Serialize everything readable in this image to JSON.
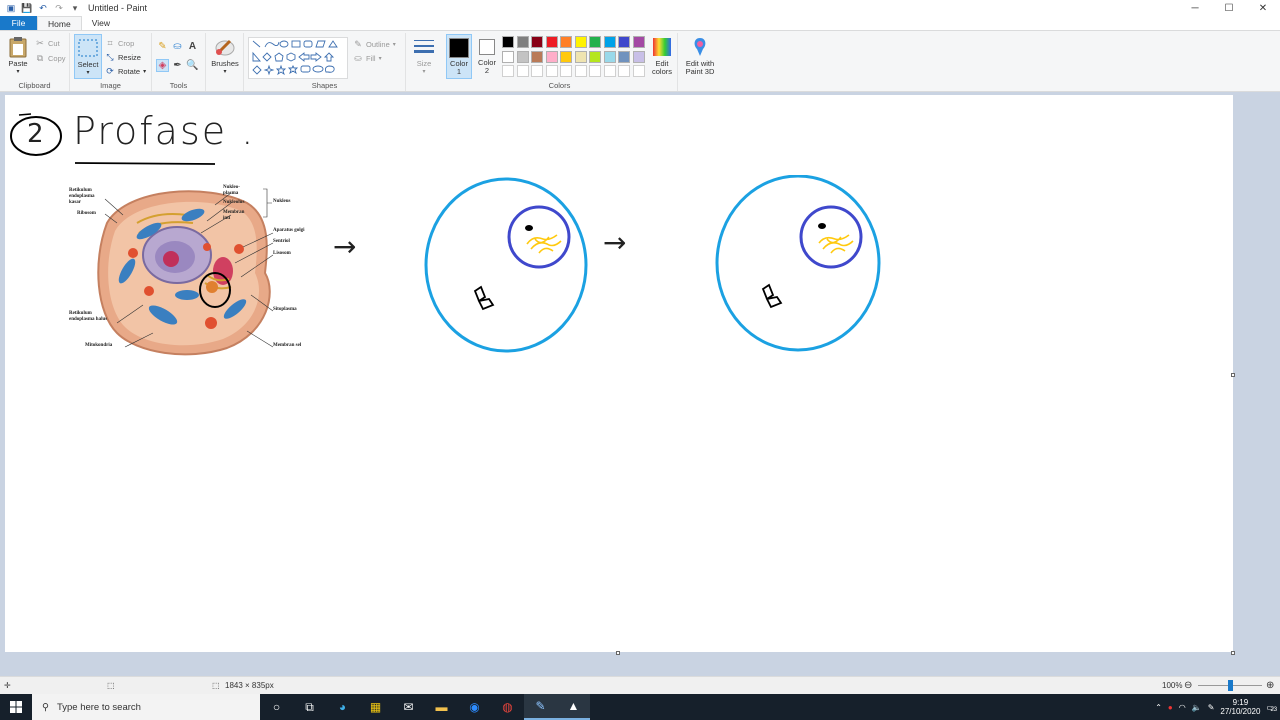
{
  "window": {
    "title": "Untitled - Paint",
    "controls": {
      "minimize": "─",
      "maximize": "☐",
      "close": "✕"
    }
  },
  "menu": {
    "file": "File",
    "tabs": [
      "Home",
      "View"
    ],
    "active_tab": "Home"
  },
  "ribbon": {
    "clipboard": {
      "label": "Clipboard",
      "paste": "Paste",
      "cut": "Cut",
      "copy": "Copy"
    },
    "image": {
      "label": "Image",
      "select": "Select",
      "crop": "Crop",
      "resize": "Resize",
      "rotate": "Rotate"
    },
    "tools": {
      "label": "Tools"
    },
    "brushes": {
      "label": "Brushes"
    },
    "shapes": {
      "label": "Shapes",
      "outline": "Outline",
      "fill": "Fill"
    },
    "size": {
      "label": "Size"
    },
    "color1": {
      "label": "Color\n1",
      "value": "#000000"
    },
    "color2": {
      "label": "Color\n2",
      "value": "#ffffff"
    },
    "colors": {
      "label": "Colors"
    },
    "edit_colors": "Edit\ncolors",
    "edit_paint3d": "Edit with\nPaint 3D",
    "palette_row1": [
      "#000000",
      "#7f7f7f",
      "#880015",
      "#ed1c24",
      "#ff7f27",
      "#fff200",
      "#22b14c",
      "#00a2e8",
      "#3f48cc",
      "#a349a4"
    ],
    "palette_row2": [
      "#ffffff",
      "#c3c3c3",
      "#b97a57",
      "#ffaec9",
      "#ffc90e",
      "#efe4b0",
      "#b5e61d",
      "#99d9ea",
      "#7092be",
      "#c8bfe7"
    ]
  },
  "canvas": {
    "heading_number": "2",
    "heading_text": "Profase .",
    "cell_labels": {
      "retikulum_kasar": "Retikulum endoplasma kasar",
      "ribosom": "Ribosom",
      "nukleoplasma": "Nukleo- plasma",
      "nukleolus": "Nukleolus",
      "membran_inti": "Membran inti",
      "nukleus": "Nukleus",
      "aparatus_golgi": "Aparatus golgi",
      "sentriol": "Sentriol",
      "lisosom": "Lisosom",
      "retikulum_halus": "Retikulum endoplasma halus",
      "sitoplasma": "Sitoplasma",
      "mitokondria": "Mitokondria",
      "membran_sel": "Membran sel"
    },
    "arrow1": "→",
    "arrow2": "→"
  },
  "status": {
    "dimensions": "1843 × 835px",
    "zoom": "100%"
  },
  "taskbar": {
    "search_placeholder": "Type here to search",
    "time": "9:19",
    "date": "27/10/2020",
    "notification_count": "23"
  }
}
